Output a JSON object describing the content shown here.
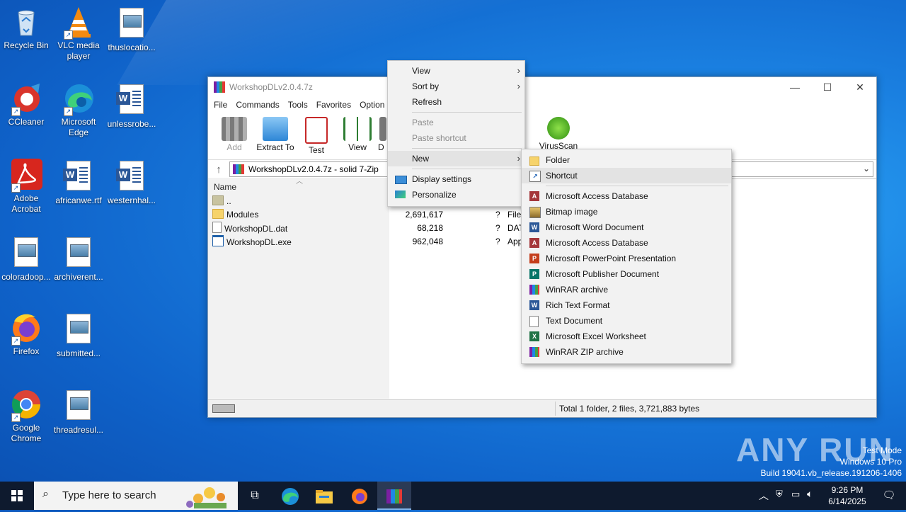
{
  "desktop": {
    "icons": [
      {
        "label": "Recycle Bin"
      },
      {
        "label": "VLC media player"
      },
      {
        "label": "thuslocatio..."
      },
      {
        "label": "CCleaner"
      },
      {
        "label": "Microsoft Edge"
      },
      {
        "label": "unlessrobe..."
      },
      {
        "label": "Adobe Acrobat"
      },
      {
        "label": "africanwe.rtf"
      },
      {
        "label": "westernhal..."
      },
      {
        "label": "coloradoop..."
      },
      {
        "label": "archiverent..."
      },
      {
        "label": "Firefox"
      },
      {
        "label": "submitted..."
      },
      {
        "label": "Google Chrome"
      },
      {
        "label": "threadresul..."
      }
    ]
  },
  "window": {
    "title": "WorkshopDLv2.0.4.7z",
    "menu": [
      "File",
      "Commands",
      "Tools",
      "Favorites",
      "Option"
    ],
    "toolbar": {
      "add": "Add",
      "extract": "Extract To",
      "test": "Test",
      "view": "View",
      "delete_partial": "D",
      "virusscan": "VirusScan"
    },
    "address": "WorkshopDLv2.0.4.7z - solid 7-Zip",
    "column_name": "Name",
    "files": [
      {
        "name": "..",
        "size": "",
        "packed": "",
        "type": ""
      },
      {
        "name": "Modules",
        "size": "2,691,617",
        "packed": "?",
        "type": "File"
      },
      {
        "name": "WorkshopDL.dat",
        "size": "68,218",
        "packed": "?",
        "type": "DAT"
      },
      {
        "name": "WorkshopDL.exe",
        "size": "962,048",
        "packed": "?",
        "type": "App"
      }
    ],
    "status": "Total 1 folder, 2 files, 3,721,883 bytes"
  },
  "context_menu": {
    "view": "View",
    "sort_by": "Sort by",
    "refresh": "Refresh",
    "paste": "Paste",
    "paste_shortcut": "Paste shortcut",
    "new": "New",
    "display_settings": "Display settings",
    "personalize": "Personalize"
  },
  "new_submenu": [
    {
      "label": "Folder",
      "icon": "folder-icon"
    },
    {
      "label": "Shortcut",
      "icon": "shortcut-icon"
    },
    {
      "label": "Microsoft Access Database",
      "icon": "access-icon"
    },
    {
      "label": "Bitmap image",
      "icon": "bitmap-icon"
    },
    {
      "label": "Microsoft Word Document",
      "icon": "word-icon"
    },
    {
      "label": "Microsoft Access Database",
      "icon": "access-icon"
    },
    {
      "label": "Microsoft PowerPoint Presentation",
      "icon": "powerpoint-icon"
    },
    {
      "label": "Microsoft Publisher Document",
      "icon": "publisher-icon"
    },
    {
      "label": "WinRAR archive",
      "icon": "winrar-icon"
    },
    {
      "label": "Rich Text Format",
      "icon": "rtf-icon"
    },
    {
      "label": "Text Document",
      "icon": "text-icon"
    },
    {
      "label": "Microsoft Excel Worksheet",
      "icon": "excel-icon"
    },
    {
      "label": "WinRAR ZIP archive",
      "icon": "winrar-zip-icon"
    }
  ],
  "taskbar": {
    "search_placeholder": "Type here to search",
    "time": "9:26 PM",
    "date": "6/14/2025"
  },
  "watermark": {
    "line1": "Test Mode",
    "line2": "Windows 10 Pro",
    "line3": "Build 19041.vb_release.191206-1406",
    "brand": "ANY RUN"
  },
  "colors": {
    "desktop_blue": "#1a7fe0",
    "taskbar": "#0e1a2e",
    "menu_bg": "#f2f2f2"
  }
}
